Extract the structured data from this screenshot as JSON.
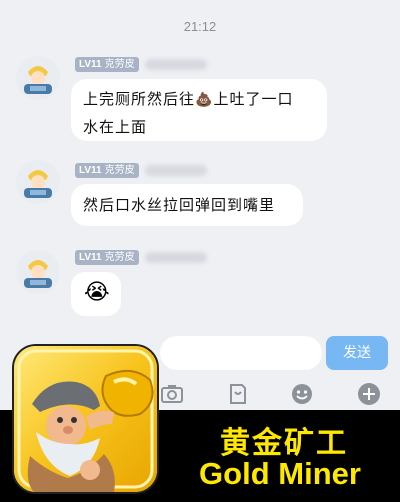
{
  "timestamp": "21:12",
  "messages": [
    {
      "level": "LV11",
      "nickname": "克劳皮",
      "text_line1": "上完厕所然后往",
      "emoji": "💩",
      "text_line1b": "上吐了一口",
      "text_line2": "水在上面"
    },
    {
      "level": "LV11",
      "nickname": "克劳皮",
      "text": "然后口水丝拉回弹回到嘴里"
    },
    {
      "level": "LV11",
      "nickname": "克劳皮",
      "emoji": "😭"
    }
  ],
  "composer": {
    "send_label": "发送"
  },
  "toolbar_icons": [
    "camera-icon",
    "file-icon",
    "emoji-face-icon",
    "plus-icon"
  ],
  "promo": {
    "title_cn": "黄金矿工",
    "title_en": "Gold Miner"
  },
  "colors": {
    "send_button": "#76b7f4",
    "promo_text": "#ffe800",
    "level_badge": "#a8b4c6"
  }
}
